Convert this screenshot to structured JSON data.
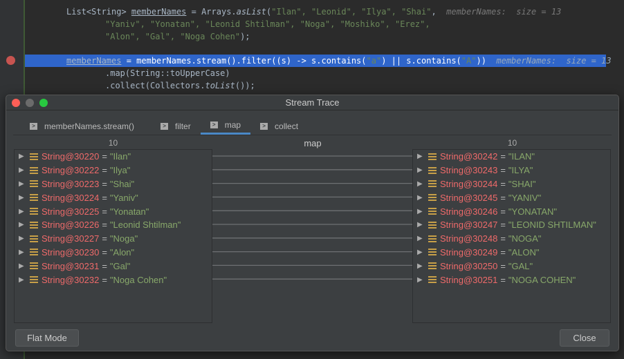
{
  "editor": {
    "line1": {
      "a": "List<String> ",
      "b": "memberNames",
      "c": " = Arrays.",
      "d": "asList",
      "e": "(",
      "s": "\"Ilan\", \"Leonid\", \"Ilya\", \"Shai\"",
      "f": ",",
      "hint": "memberNames:  size = 13"
    },
    "line2": "\"Yaniv\", \"Yonatan\", \"Leonid Shtilman\", \"Noga\", \"Moshiko\", \"Erez\",",
    "line3": {
      "s": "\"Alon\", \"Gal\", \"Noga Cohen\"",
      "e": ");"
    },
    "line4": {
      "a": "memberNames",
      "b": " = memberNames.stream().filter((s) -> s.contains(",
      "s1": "\"a\"",
      "c": ") || s.contains(",
      "s2": "\"A\"",
      "d": "))",
      "hint": "memberNames:  size = 13"
    },
    "line5": ".map(String::toUpperCase)",
    "line6": {
      "a": ".collect(Collectors.",
      "b": "toList",
      "c": "());"
    }
  },
  "dialog": {
    "title": "Stream Trace",
    "tabs": [
      {
        "label": "memberNames.stream()"
      },
      {
        "label": "filter"
      },
      {
        "label": "map"
      },
      {
        "label": "collect"
      }
    ],
    "left_count": "10",
    "middle_label": "map",
    "right_count": "10",
    "left_items": [
      {
        "obj": "String@30220",
        "val": "\"Ilan\""
      },
      {
        "obj": "String@30222",
        "val": "\"Ilya\""
      },
      {
        "obj": "String@30223",
        "val": "\"Shai\""
      },
      {
        "obj": "String@30224",
        "val": "\"Yaniv\""
      },
      {
        "obj": "String@30225",
        "val": "\"Yonatan\""
      },
      {
        "obj": "String@30226",
        "val": "\"Leonid Shtilman\""
      },
      {
        "obj": "String@30227",
        "val": "\"Noga\""
      },
      {
        "obj": "String@30230",
        "val": "\"Alon\""
      },
      {
        "obj": "String@30231",
        "val": "\"Gal\""
      },
      {
        "obj": "String@30232",
        "val": "\"Noga Cohen\""
      }
    ],
    "right_items": [
      {
        "obj": "String@30242",
        "val": "\"ILAN\""
      },
      {
        "obj": "String@30243",
        "val": "\"ILYA\""
      },
      {
        "obj": "String@30244",
        "val": "\"SHAI\""
      },
      {
        "obj": "String@30245",
        "val": "\"YANIV\""
      },
      {
        "obj": "String@30246",
        "val": "\"YONATAN\""
      },
      {
        "obj": "String@30247",
        "val": "\"LEONID SHTILMAN\""
      },
      {
        "obj": "String@30248",
        "val": "\"NOGA\""
      },
      {
        "obj": "String@30249",
        "val": "\"ALON\""
      },
      {
        "obj": "String@30250",
        "val": "\"GAL\""
      },
      {
        "obj": "String@30251",
        "val": "\"NOGA COHEN\""
      }
    ],
    "flat_mode": "Flat Mode",
    "close": "Close"
  },
  "colors": {
    "accent": "#4a88c7",
    "highlight": "#2f65ca"
  }
}
